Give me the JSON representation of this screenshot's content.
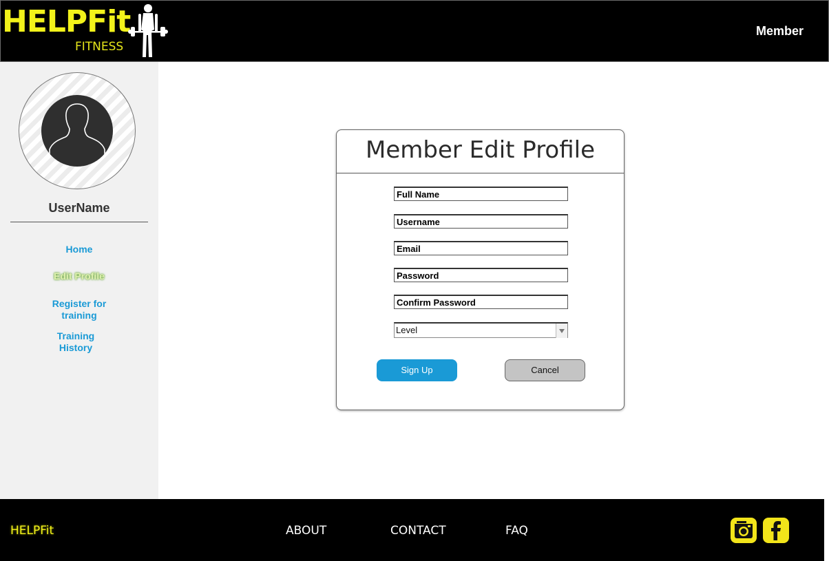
{
  "header": {
    "logo_title": "HELPFit",
    "logo_subtitle": "FITNESS",
    "role": "Member"
  },
  "sidebar": {
    "username": "UserName",
    "items": [
      {
        "label": "Home",
        "active": false
      },
      {
        "label": "Edit Profile",
        "active": true
      },
      {
        "label": "Register for\ntraining",
        "active": false
      },
      {
        "label": "Training\nHistory",
        "active": false
      }
    ]
  },
  "form": {
    "title": "Member Edit Profile",
    "fields": [
      {
        "placeholder": "Full Name"
      },
      {
        "placeholder": "Username"
      },
      {
        "placeholder": "Email"
      },
      {
        "placeholder": "Password"
      },
      {
        "placeholder": "Confirm Password"
      }
    ],
    "level_select": {
      "value": "Level"
    },
    "submit_label": "Sign Up",
    "cancel_label": "Cancel"
  },
  "footer": {
    "brand": "HELPFit",
    "links": [
      {
        "label": "ABOUT"
      },
      {
        "label": "CONTACT"
      },
      {
        "label": "FAQ"
      }
    ],
    "social": [
      "instagram-icon",
      "facebook-icon"
    ]
  },
  "colors": {
    "brand_yellow": "#f2f21a",
    "link_blue": "#1a9ad6",
    "active_green": "#6aa83a"
  }
}
